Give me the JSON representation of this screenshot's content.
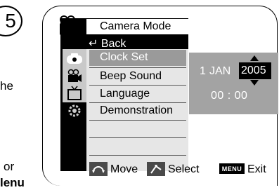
{
  "page": {
    "step_number": "5",
    "fragments": [
      "he",
      "or",
      "lenu"
    ]
  },
  "menu": {
    "title": "Camera Mode",
    "back": "↵ Back",
    "items": [
      {
        "label": "Clock Set",
        "selected": true
      },
      {
        "label": "Beep Sound",
        "selected": false
      },
      {
        "label": "Language",
        "selected": false
      },
      {
        "label": "Demonstration",
        "selected": false
      }
    ],
    "tab_icons": [
      "camera-tab-icon",
      "camcorder-tab-icon",
      "tv-tab-icon",
      "settings-tab-icon"
    ]
  },
  "clock": {
    "day": "1",
    "month": "JAN",
    "year": "2005",
    "time": "00 : 00"
  },
  "guide": {
    "move": "Move",
    "select": "Select",
    "menu_key": "MENU",
    "exit": "Exit"
  },
  "colors": {
    "highlight": "#9a9a9a",
    "panel": "#000000",
    "clock_panel": "#a3a3a3"
  }
}
